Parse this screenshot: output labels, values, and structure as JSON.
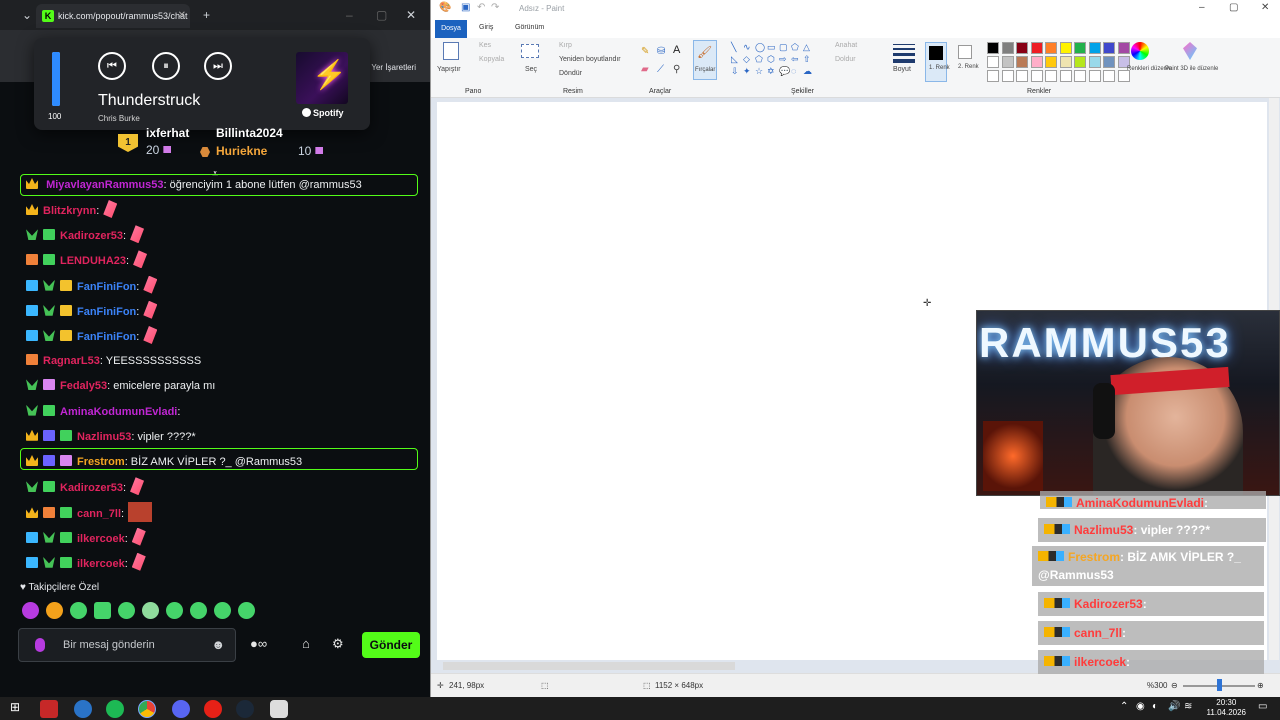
{
  "browser": {
    "tab_title": "kick.com/popout/rammus53/chat",
    "tab_logo": "K",
    "new_tab": "+",
    "bookmark_label": "Yer İşaretleri"
  },
  "media": {
    "volume": 100,
    "volume_fraction": 1.0,
    "title": "Thunderstruck",
    "artist": "Chris Burke",
    "source": "Spotify",
    "prev_icon": "⏮",
    "pause_icon": "⏸",
    "next_icon": "⏭"
  },
  "leaderboard": {
    "first_name": "ixferhat",
    "first_score": "20",
    "second_name": "Billinta2024",
    "third_name": "Huriekne",
    "third_score": "10"
  },
  "chat": {
    "top_msg_user": "MiyavlayanRammus53",
    "top_msg_text": ": öğrenciyim 1 abone lütfen @rammus53",
    "messages": [
      {
        "user": "Blitzkrynn",
        "color": "#e0245e",
        "text": ":"
      },
      {
        "user": "Kadirozer53",
        "color": "#e0245e",
        "text": ":"
      },
      {
        "user": "LENDUHA23",
        "color": "#e0245e",
        "text": ":"
      },
      {
        "user": "FanFiniFon",
        "color": "#3b82f6",
        "text": ":"
      },
      {
        "user": "FanFiniFon",
        "color": "#3b82f6",
        "text": ":"
      },
      {
        "user": "FanFiniFon",
        "color": "#3b82f6",
        "text": ":"
      },
      {
        "user": "RagnarL53",
        "color": "#e0245e",
        "text": ": YEESSSSSSSSSS"
      },
      {
        "user": "Fedaly53",
        "color": "#e0245e",
        "text": ": emicelere parayla mı"
      },
      {
        "user": "AminaKodumunEvladi",
        "color": "#c026d3",
        "text": ":"
      },
      {
        "user": "Nazlimu53",
        "color": "#e0245e",
        "text": ": vipler ????*"
      },
      {
        "user": "Frestrom",
        "color": "#f5a623",
        "text": ": BİZ AMK VİPLER ?_ @Rammus53"
      },
      {
        "user": "Kadirozer53",
        "color": "#e0245e",
        "text": ":"
      },
      {
        "user": "cann_7ll",
        "color": "#e0245e",
        "text": ":"
      },
      {
        "user": "ilkercoek",
        "color": "#e0245e",
        "text": ":"
      },
      {
        "user": "ilkercoek",
        "color": "#e0245e",
        "text": ":"
      }
    ],
    "followers_only": "Takipçilere Özel",
    "input_placeholder": "Bir mesaj gönderin",
    "send_label": "Gönder"
  },
  "paint": {
    "title": "Adsız - Paint",
    "tabs": {
      "file": "Dosya",
      "home": "Giriş",
      "view": "Görünüm"
    },
    "clipboard": {
      "paste": "Yapıştır",
      "cut": "Kes",
      "copy": "Kopyala",
      "group": "Pano"
    },
    "image": {
      "select": "Seç",
      "crop": "Kırp",
      "resize": "Yeniden boyutlandır",
      "rotate": "Döndür",
      "group": "Resim"
    },
    "tools": {
      "group": "Araçlar",
      "brushes": "Fırçalar"
    },
    "shapes": {
      "outline": "Anahat",
      "fill": "Doldur",
      "group": "Şekiller"
    },
    "size": "Boyut",
    "color1": "1. Renk",
    "color2": "2. Renk",
    "edit_colors": "Renkleri düzenle",
    "paint3d": "Paint 3D ile düzenle",
    "colors_group": "Renkler",
    "palette": [
      "#000000",
      "#7f7f7f",
      "#880015",
      "#ed1c24",
      "#ff7f27",
      "#fff200",
      "#22b14c",
      "#00a2e8",
      "#3f48cc",
      "#a349a4",
      "#ffffff",
      "#c3c3c3",
      "#b97a57",
      "#ffaec9",
      "#ffc90e",
      "#efe4b0",
      "#b5e61d",
      "#99d9ea",
      "#7092be",
      "#c8bfe7"
    ],
    "status_pos": "241, 98px",
    "status_size": "1152 × 648px",
    "zoom": "%300"
  },
  "webcam": {
    "neon_text": "RAMMUS53"
  },
  "overlay_chat": [
    {
      "user": "AminaKodumunEvladi",
      "text": ":"
    },
    {
      "user": "Nazlimu53",
      "text": ": vipler ????*"
    },
    {
      "user": "Frestrom",
      "text": ": BİZ AMK VİPLER ?_ @Rammus53"
    },
    {
      "user": "Kadirozer53",
      "text": ":"
    },
    {
      "user": "cann_7ll",
      "text": ":"
    },
    {
      "user": "ilkercoek",
      "text": ":"
    }
  ],
  "taskbar": {
    "time": "20:30",
    "date": "11.04.2026"
  },
  "colors": {
    "kick_green": "#53fc18",
    "paint_blue": "#1b62bf"
  }
}
